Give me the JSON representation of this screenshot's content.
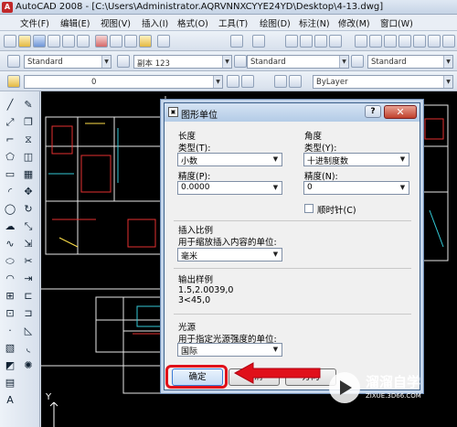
{
  "window": {
    "logo_text": "A",
    "title": "AutoCAD 2008 - [C:\\Users\\Administrator.AQRVNNXCYYE24YD\\Desktop\\4-13.dwg]"
  },
  "menus": [
    "文件(F)",
    "编辑(E)",
    "视图(V)",
    "插入(I)",
    "格式(O)",
    "工具(T)",
    "绘图(D)",
    "标注(N)",
    "修改(M)",
    "窗口(W)"
  ],
  "toolbar2": {
    "text_style": "Standard",
    "dim_style": "副本 123",
    "table_style": "Standard",
    "mleader_style": "Standard"
  },
  "toolbar3": {
    "layer_value": "0",
    "color_value": "ByLayer"
  },
  "dialog": {
    "title": "图形单位",
    "help_label": "?",
    "close_label": "✕",
    "length": {
      "heading": "长度",
      "type_label": "类型(T):",
      "type_value": "小数",
      "precision_label": "精度(P):",
      "precision_value": "0.0000"
    },
    "angle": {
      "heading": "角度",
      "type_label": "类型(Y):",
      "type_value": "十进制度数",
      "precision_label": "精度(N):",
      "precision_value": "0",
      "clockwise_label": "顺时针(C)"
    },
    "insertion": {
      "heading": "插入比例",
      "desc": "用于缩放插入内容的单位:",
      "value": "毫米"
    },
    "sample": {
      "heading": "输出样例",
      "line1": "1.5,2.0039,0",
      "line2": "3<45,0"
    },
    "lighting": {
      "heading": "光源",
      "desc": "用于指定光源强度的单位:",
      "value": "国际"
    },
    "buttons": {
      "ok": "确定",
      "cancel": "取消",
      "direction": "方向"
    }
  },
  "canvas": {
    "ucs_y_label": "Y"
  },
  "watermark": {
    "name": "溜溜自学",
    "url": "ZIXUE.3D66.COM"
  },
  "colors": {
    "highlight": "#e0101a",
    "canvas_bg": "#000000"
  }
}
